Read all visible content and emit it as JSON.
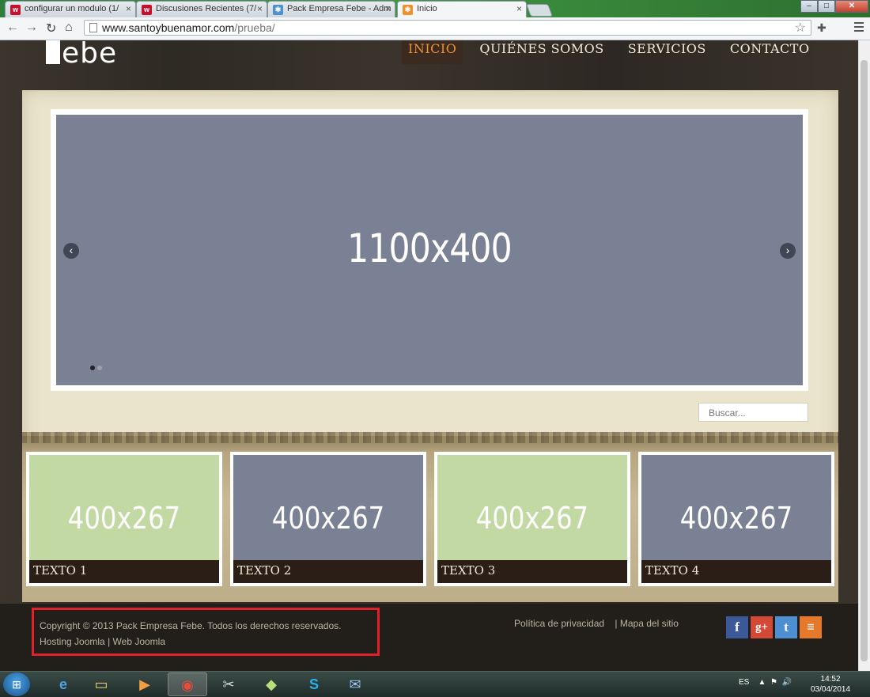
{
  "browser": {
    "tabs": [
      {
        "title": "configurar un modulo (1/",
        "favicon": "w",
        "favicon_color": "#c8102e"
      },
      {
        "title": "Discusiones Recientes (7/",
        "favicon": "w",
        "favicon_color": "#c8102e"
      },
      {
        "title": "Pack Empresa Febe - Adm",
        "favicon": "joomla-icon",
        "favicon_color": "#5091cd"
      },
      {
        "title": "Inicio",
        "favicon": "joomla-icon",
        "favicon_color": "#f0902c"
      }
    ],
    "active_tab": 3,
    "url_host": "www.santoybuenamor.com",
    "url_path": "/prueba/"
  },
  "site": {
    "logo_text": "ebe",
    "nav": [
      {
        "label": "INICIO",
        "active": true
      },
      {
        "label": "QUIÉNES SOMOS",
        "active": false
      },
      {
        "label": "SERVICIOS",
        "active": false
      },
      {
        "label": "CONTACTO",
        "active": false
      }
    ],
    "slider": {
      "label": "1100x400",
      "prev": "‹",
      "next": "›",
      "dots": 2,
      "current": 0,
      "color": "#7b8194"
    },
    "search_placeholder": "Buscar...",
    "cards": [
      {
        "dim": "400x267",
        "caption": "TEXTO 1",
        "color": "#c2d9a3"
      },
      {
        "dim": "400x267",
        "caption": "TEXTO 2",
        "color": "#7b8194"
      },
      {
        "dim": "400x267",
        "caption": "TEXTO 3",
        "color": "#c2d9a3"
      },
      {
        "dim": "400x267",
        "caption": "TEXTO 4",
        "color": "#7b8194"
      }
    ],
    "footer": {
      "copyright": "Copyright © 2013 Pack Empresa Febe. Todos los derechos reservados.",
      "hosting_link": "Hosting Joomla",
      "separator": "|",
      "web_link": "Web Joomla",
      "privacy": "Política de privacidad",
      "sitemap": "Mapa del sitio",
      "social": [
        {
          "name": "facebook",
          "glyph": "f",
          "color": "#3b5998"
        },
        {
          "name": "google-plus",
          "glyph": "g+",
          "color": "#d34836"
        },
        {
          "name": "twitter",
          "glyph": "t",
          "color": "#4d8fd1"
        },
        {
          "name": "rss",
          "glyph": "≡",
          "color": "#e6782a"
        }
      ]
    }
  },
  "taskbar": {
    "language": "ES",
    "time": "14:52",
    "date": "03/04/2014"
  }
}
